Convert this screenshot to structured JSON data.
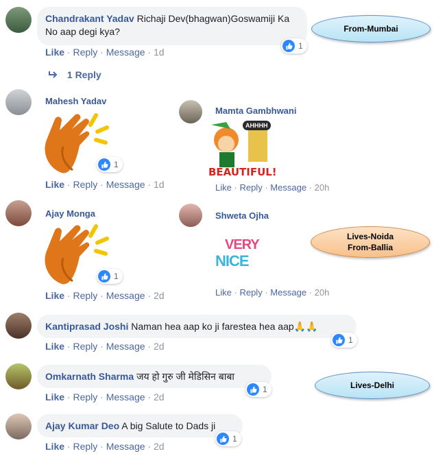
{
  "comments": [
    {
      "author": "Chandrakant Yadav",
      "text": "Richaji Dev(bhagwan)Goswamiji Ka No aap degi kya?",
      "reactions": "1",
      "time": "1d"
    },
    {
      "author": "Mahesh Yadav",
      "reactions": "1",
      "time": "1d"
    },
    {
      "author": "Mamta Gambhwani",
      "sticker_text": [
        "AHHHH",
        "BEAUTIFUL!"
      ],
      "time": "20h"
    },
    {
      "author": "Ajay Monga",
      "reactions": "1",
      "time": "2d"
    },
    {
      "author": "Shweta Ojha",
      "sticker_text": [
        "VERY",
        "NICE"
      ],
      "time": "20h"
    },
    {
      "author": "Kantiprasad Joshi",
      "text": "Naman hea aap ko ji farestea hea aap🙏🙏",
      "reactions": "1",
      "time": "2d"
    },
    {
      "author": "Omkarnath Sharma",
      "text": "जय हो गुरु जी मेडिसिन बाबा",
      "reactions": "1",
      "time": "2d"
    },
    {
      "author": "Ajay Kumar Deo",
      "text": "A big Salute to Dads ji",
      "reactions": "1",
      "time": "2d"
    }
  ],
  "actions": {
    "like": "Like",
    "reply": "Reply",
    "message": "Message",
    "sep": "·"
  },
  "replies_link": "1 Reply",
  "callouts": {
    "mumbai": "From-Mumbai",
    "noida_line1": "Lives-Noida",
    "noida_line2": "From-Ballia",
    "delhi": "Lives-Delhi"
  },
  "colors": {
    "name": "#385898",
    "action": "#4b67a1",
    "bubble": "#f2f3f5",
    "like": "#2d88ff",
    "clap": "#e0761a"
  }
}
